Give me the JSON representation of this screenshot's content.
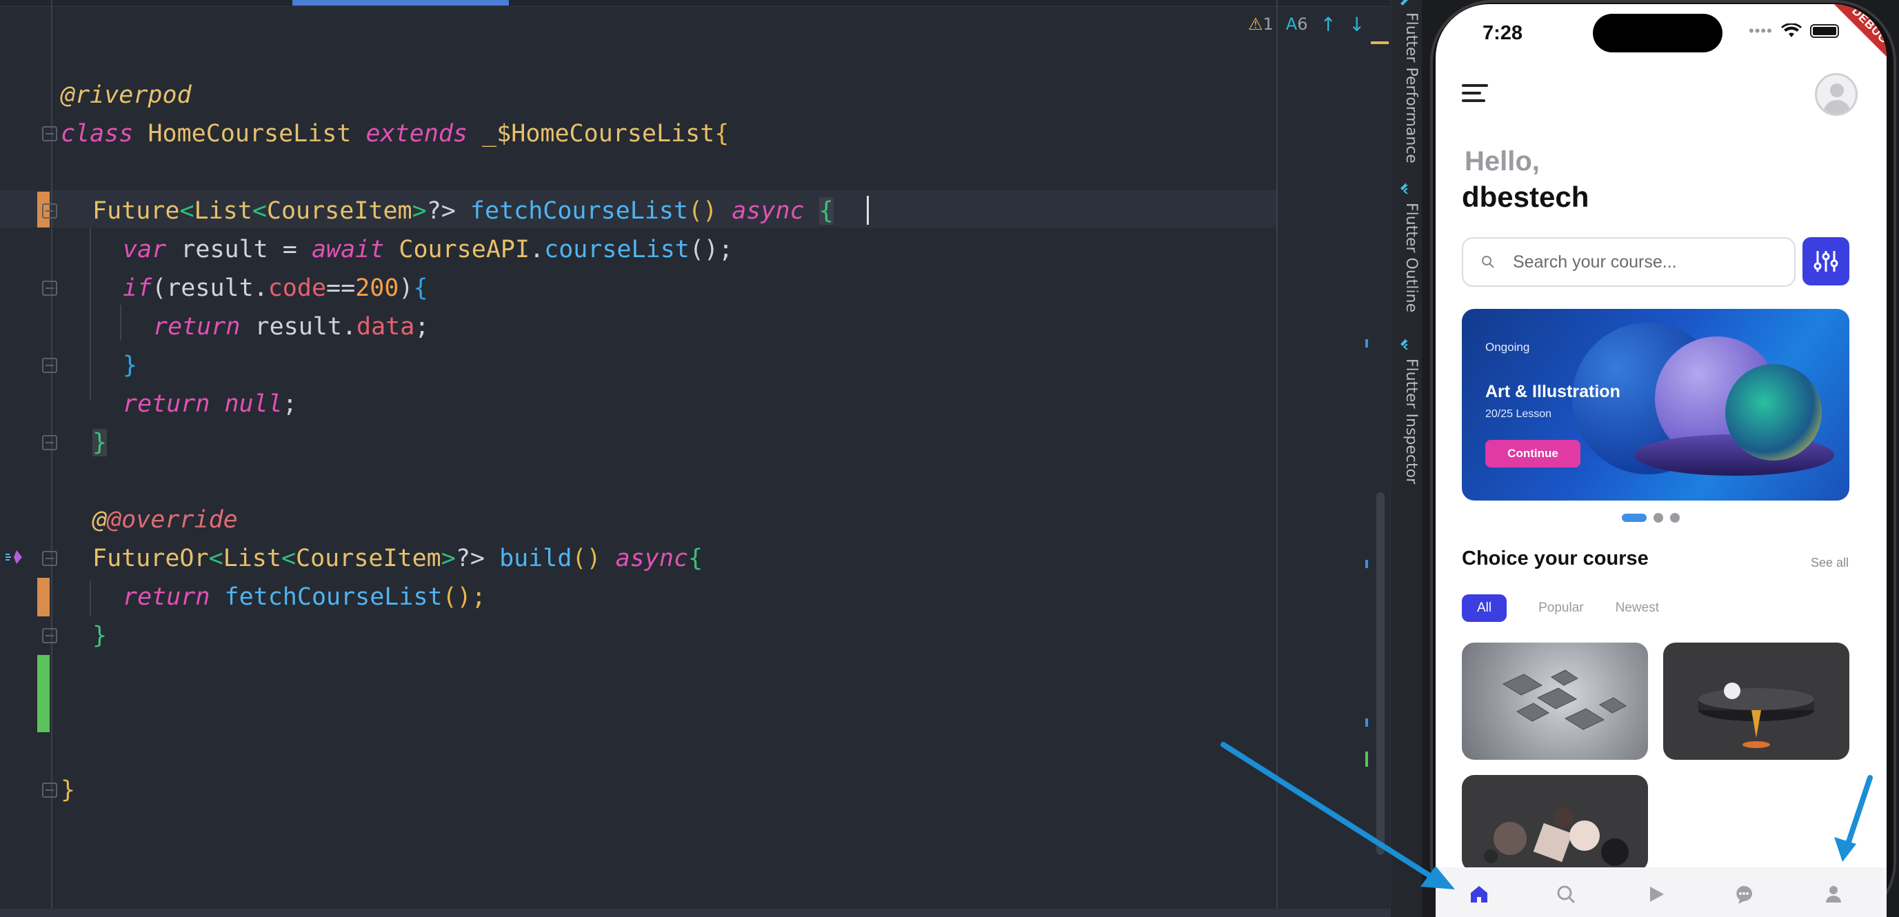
{
  "ide": {
    "inspections": {
      "warnings": "1",
      "typos": "6",
      "up": "↑",
      "down": "↓"
    },
    "code": {
      "l1": "@riverpod",
      "l2_class": "class",
      "l2_name": "HomeCourseList",
      "l2_extends": "extends",
      "l2_base": "_$HomeCourseList",
      "l2_open": "{",
      "l4_type1": "Future",
      "l4_type2": "List",
      "l4_type3": "CourseItem",
      "l4_q": "?>",
      "l4_fn": "fetchCourseList",
      "l4_parens": "()",
      "l4_async": "async",
      "l4_open": "{",
      "l5_var": "var",
      "l5_result": "result =",
      "l5_await": "await",
      "l5_api": "CourseAPI",
      "l5_dot": ".",
      "l5_fn": "courseList",
      "l5_end": "();",
      "l6_if": "if",
      "l6_open": "(result.",
      "l6_code": "code",
      "l6_eq": "==",
      "l6_num": "200",
      "l6_close": ")",
      "l6_brace": "{",
      "l7_return": "return",
      "l7_result": "result.",
      "l7_data": "data",
      "l7_end": ";",
      "l8_close": "}",
      "l9_return": "return",
      "l9_null": "null",
      "l9_end": ";",
      "l10_close": "}",
      "l12_ann": "@override",
      "l13_type1": "FutureOr",
      "l13_type2": "List",
      "l13_type3": "CourseItem",
      "l13_q": "?>",
      "l13_fn": "build",
      "l13_parens": "()",
      "l13_async": "async",
      "l13_open": "{",
      "l14_return": "return",
      "l14_fn": "fetchCourseList",
      "l14_end": "();",
      "l15_close": "}",
      "l19_close": "}"
    }
  },
  "side_panels": [
    "Flutter Performance",
    "Flutter Outline",
    "Flutter Inspector"
  ],
  "phone": {
    "status": {
      "time": "7:28",
      "debug_ribbon": "DEBUG"
    },
    "greeting": {
      "hello": "Hello,",
      "name": "dbestech"
    },
    "search": {
      "placeholder": "Search your course..."
    },
    "banner": {
      "tag": "Ongoing",
      "title": "Art & Illustration",
      "subtitle": "20/25 Lesson",
      "button": "Continue"
    },
    "section": {
      "title": "Choice your course",
      "see_all": "See all"
    },
    "tabs": [
      "All",
      "Popular",
      "Newest"
    ],
    "bottom_nav": [
      "home-icon",
      "search-icon",
      "play-icon",
      "chat-icon",
      "profile-icon"
    ]
  },
  "colors": {
    "ide_bg": "#262a33",
    "accent_blue": "#3b3fe0",
    "banner_button": "#e03aa4",
    "annotation_arrow": "#1a8fd6"
  }
}
